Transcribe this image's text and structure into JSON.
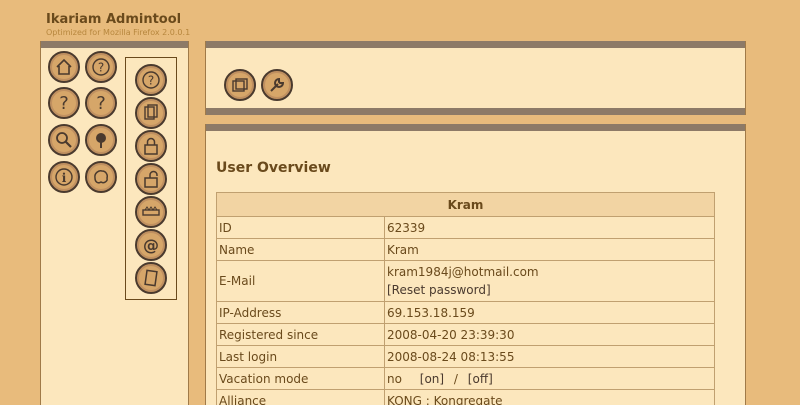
{
  "header": {
    "title": "Ikariam Admintool",
    "subtitle": "Optimized for Mozilla Firefox 2.0.0.1"
  },
  "nav": {
    "main_icons": [
      "home-icon",
      "help-icon",
      "help-icon",
      "help-icon",
      "search-icon",
      "pin-icon",
      "info-icon",
      "world-icon"
    ],
    "sub_icons": [
      "help-icon",
      "documents-icon",
      "lock-icon",
      "unlock-icon",
      "bar-icon",
      "at-icon",
      "notes-icon"
    ]
  },
  "toolbar": {
    "icons": [
      "folders-icon",
      "wrench-icon"
    ]
  },
  "main": {
    "section_title": "User Overview",
    "table_header": "Kram",
    "rows": [
      {
        "label": "ID",
        "value": "62339"
      },
      {
        "label": "Name",
        "value": "Kram"
      },
      {
        "label": "E-Mail",
        "value": "kram1984j@hotmail.com",
        "action": "[Reset password]"
      },
      {
        "label": "IP-Address",
        "value": "69.153.18.159"
      },
      {
        "label": "Registered since",
        "value": "2008-04-20 23:39:30"
      },
      {
        "label": "Last login",
        "value": "2008-08-24 08:13:55"
      },
      {
        "label": "Vacation mode",
        "value": "no",
        "on": "[on]",
        "sep": "/",
        "off": "[off]"
      },
      {
        "label": "Alliance",
        "value": "KONG : Kongregate"
      }
    ]
  }
}
